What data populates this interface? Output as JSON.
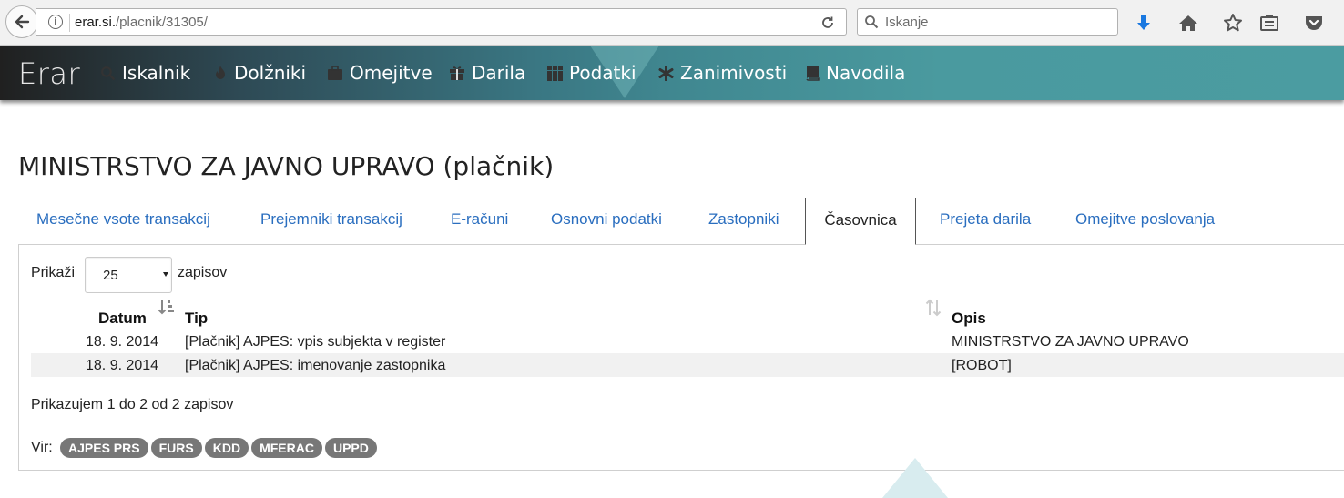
{
  "browser": {
    "url_host": "erar.si.",
    "url_path": "/placnik/31305/",
    "search_placeholder": "Iskanje"
  },
  "navbar": {
    "brand": "Erar",
    "items": [
      {
        "label": "Iskalnik",
        "icon": "search-icon"
      },
      {
        "label": "Dolžniki",
        "icon": "fire-icon"
      },
      {
        "label": "Omejitve",
        "icon": "briefcase-icon"
      },
      {
        "label": "Darila",
        "icon": "gift-icon"
      },
      {
        "label": "Podatki",
        "icon": "grid-icon"
      },
      {
        "label": "Zanimivosti",
        "icon": "asterisk-icon"
      },
      {
        "label": "Navodila",
        "icon": "book-icon"
      }
    ]
  },
  "page": {
    "title": "MINISTRSTVO ZA JAVNO UPRAVO (plačnik)"
  },
  "tabs": [
    {
      "label": "Mesečne vsote transakcij"
    },
    {
      "label": "Prejemniki transakcij"
    },
    {
      "label": "E-računi"
    },
    {
      "label": "Osnovni podatki"
    },
    {
      "label": "Zastopniki"
    },
    {
      "label": "Časovnica",
      "active": true
    },
    {
      "label": "Prejeta darila"
    },
    {
      "label": "Omejitve poslovanja"
    }
  ],
  "table": {
    "show_label": "Prikaži",
    "page_size": "25",
    "records_label": "zapisov",
    "columns": [
      "Datum",
      "Tip",
      "Opis"
    ],
    "rows": [
      {
        "datum": "18. 9. 2014",
        "tip": "[Plačnik] AJPES: vpis subjekta v register",
        "opis": "MINISTRSTVO ZA JAVNO UPRAVO"
      },
      {
        "datum": "18. 9. 2014",
        "tip": "[Plačnik] AJPES: imenovanje zastopnika",
        "opis": "[ROBOT]"
      }
    ],
    "summary": "Prikazujem 1 do 2 od 2 zapisov"
  },
  "sources": {
    "label": "Vir:",
    "badges": [
      "AJPES PRS",
      "FURS",
      "KDD",
      "MFERAC",
      "UPPD"
    ]
  },
  "colors": {
    "link": "#2a6ebf",
    "badge": "#777777",
    "navbar_dark": "#202020",
    "navbar_teal": "#4b9ca1"
  }
}
